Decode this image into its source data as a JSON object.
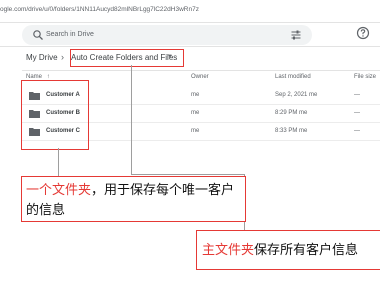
{
  "browser": {
    "url": "ogle.com/drive/u/0/folders/1NN11Aucyd82mlNBrLgg7lC22dH3wRn7z"
  },
  "search": {
    "placeholder": "Search in Drive",
    "icon": "search-icon",
    "filter_icon": "tune-icon"
  },
  "help": {
    "icon": "help-icon"
  },
  "breadcrumb": {
    "root": "My Drive",
    "separator": "›",
    "current": "Auto Create Folders and Files",
    "dropdown_icon": "caret-down-icon"
  },
  "table": {
    "columns": {
      "name": "Name",
      "sort": "↑",
      "owner": "Owner",
      "modified": "Last modified",
      "size": "File size"
    },
    "rows": [
      {
        "name": "Customer A",
        "owner": "me",
        "modified": "Sep 2, 2021",
        "modified_by": "me",
        "size": "—"
      },
      {
        "name": "Customer B",
        "owner": "me",
        "modified": "8:29 PM",
        "modified_by": "me",
        "size": "—"
      },
      {
        "name": "Customer C",
        "owner": "me",
        "modified": "8:33 PM",
        "modified_by": "me",
        "size": "—"
      }
    ]
  },
  "annotations": {
    "folder_callout": {
      "highlight": "一个文件夹",
      "rest": "，用于保存每个唯一客户的信息"
    },
    "main_callout": {
      "highlight": "主文件夹",
      "rest": "保存所有客户信息"
    },
    "highlight_color": "#e53935"
  }
}
